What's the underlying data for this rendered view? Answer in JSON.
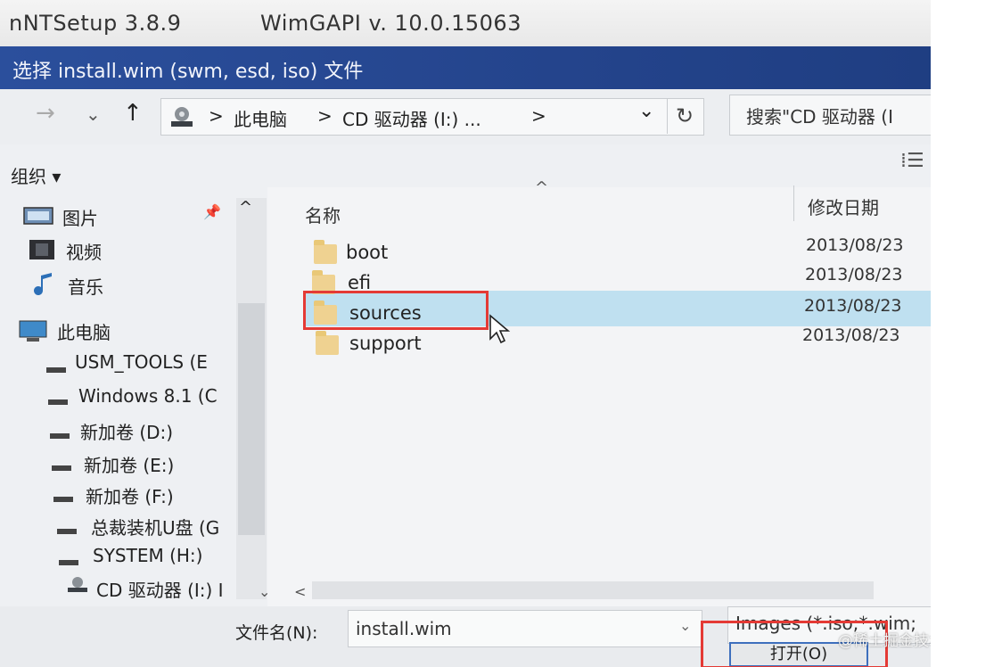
{
  "app": {
    "title": "nNTSetup 3.8.9",
    "wimgapi": "WimGAPI v. 10.0.15063"
  },
  "dialog": {
    "title": "选择 install.wim (swm, esd, iso) 文件"
  },
  "nav": {
    "back": "←",
    "forward": "→",
    "recent": "⌄",
    "up": "↑",
    "breadcrumb": [
      "此电脑",
      "CD 驱动器 (I:) ..."
    ],
    "sep": ">",
    "refresh": "↻",
    "dropdown": "⌄",
    "search_placeholder": "搜索\"CD 驱动器 (I"
  },
  "toolbar": {
    "organize": "组织 ▾",
    "view": "⁞☰"
  },
  "sidebar": {
    "quick": [
      {
        "label": "图片",
        "icon": "pictures-icon"
      },
      {
        "label": "视频",
        "icon": "video-icon"
      },
      {
        "label": "音乐",
        "icon": "music-icon"
      }
    ],
    "this_pc": "此电脑",
    "drives": [
      "USM_TOOLS (E",
      "Windows 8.1 (C",
      "新加卷 (D:)",
      "新加卷 (E:)",
      "新加卷 (F:)",
      "总裁装机U盘 (G",
      "SYSTEM (H:)",
      "CD 驱动器 (I:) I"
    ],
    "pin": "📌",
    "collapse": "^"
  },
  "columns": {
    "name": "名称",
    "date": "修改日期"
  },
  "files": [
    {
      "name": "boot",
      "date": "2013/08/23"
    },
    {
      "name": "efi",
      "date": "2013/08/23"
    },
    {
      "name": "sources",
      "date": "2013/08/23"
    },
    {
      "name": "support",
      "date": "2013/08/23"
    }
  ],
  "footer": {
    "filename_label": "文件名(N):",
    "filename_value": "install.wim",
    "filetype": "Images (*.iso;*.wim;",
    "open_button": "打开(O)"
  },
  "watermark": "@稀土掘金技术社区",
  "colors": {
    "title_bar": "#24448c",
    "selection": "#bfe0f0",
    "highlight_box": "#e43a35",
    "folder": "#efd291"
  }
}
